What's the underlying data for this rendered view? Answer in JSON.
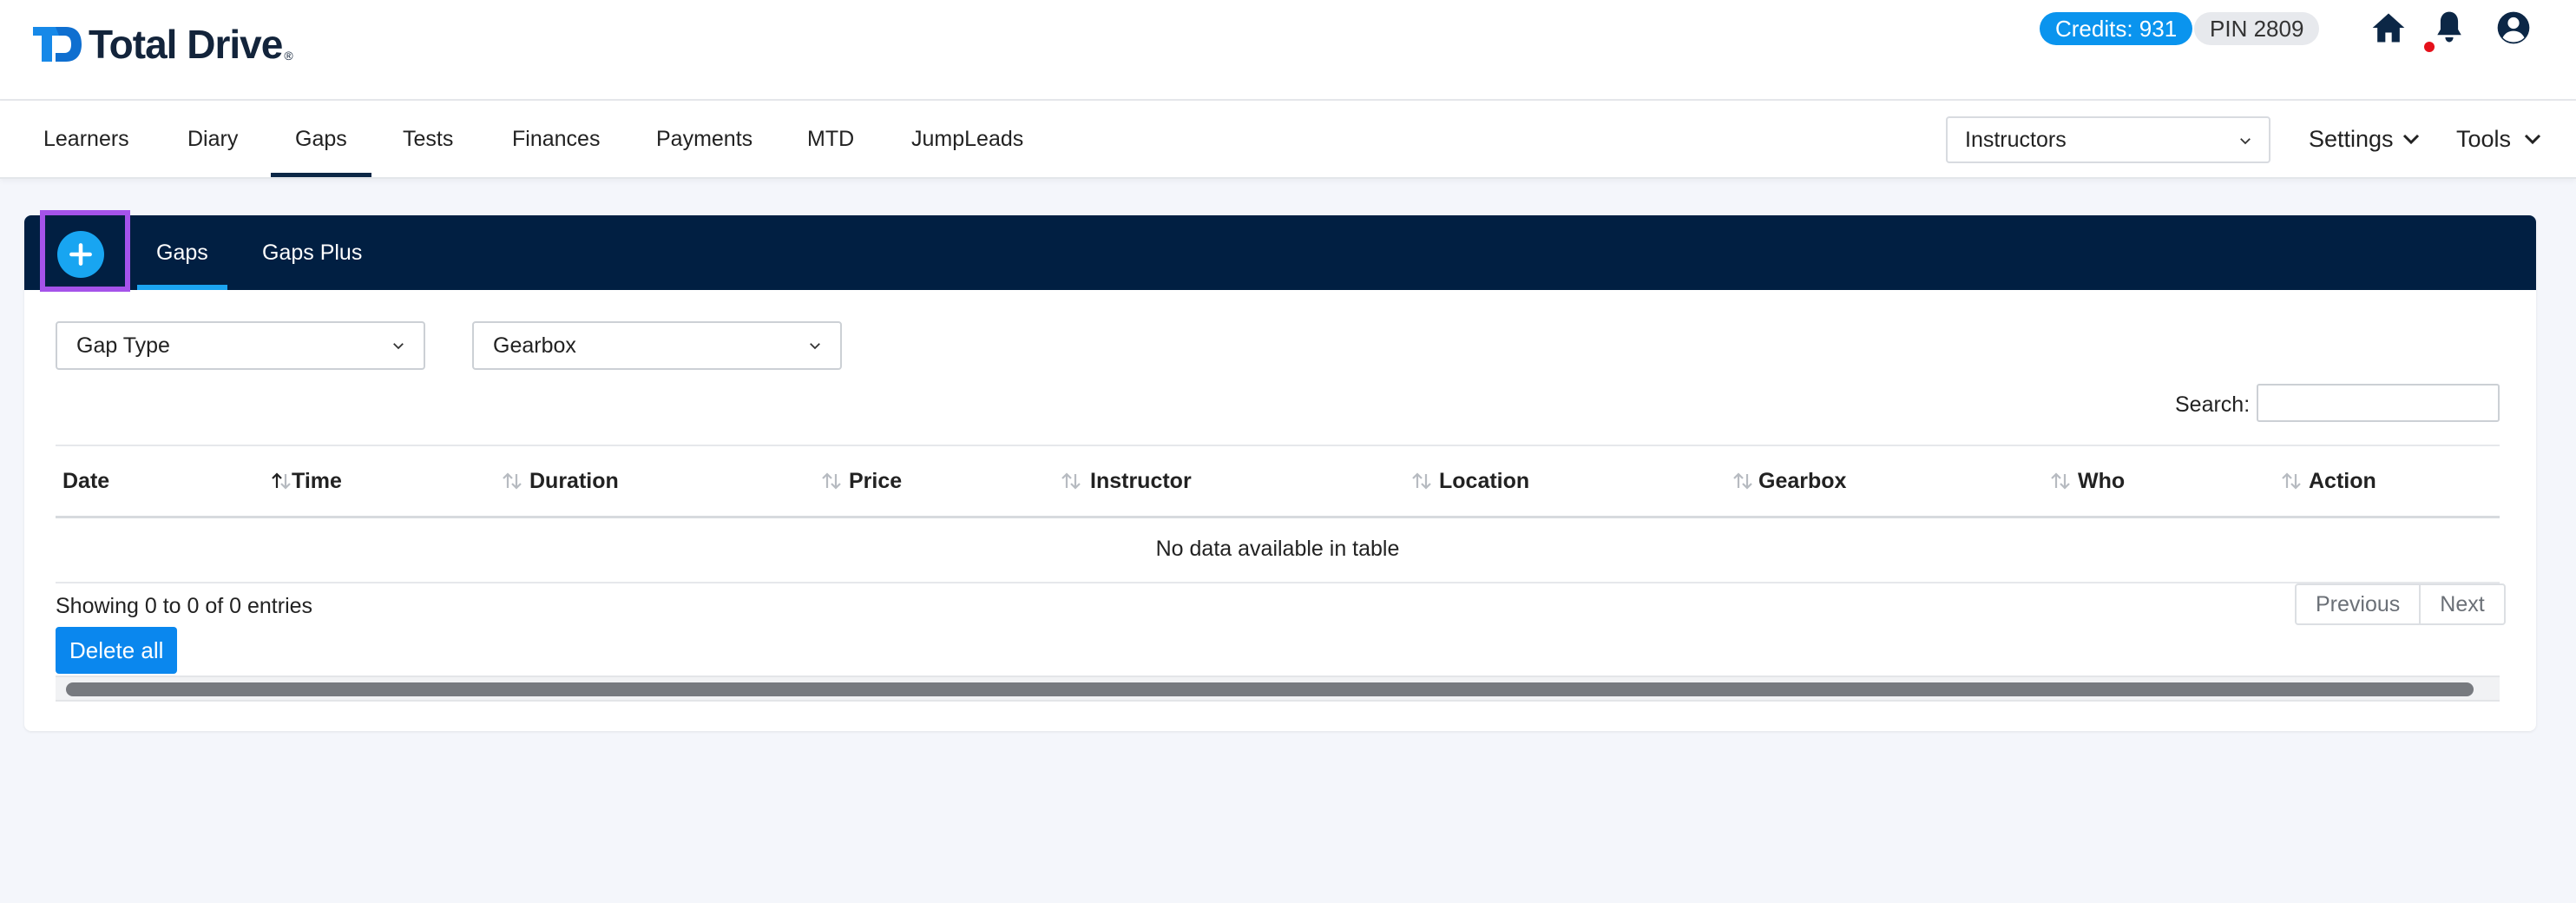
{
  "app": {
    "brand": "Total Drive",
    "brand_reg": "®",
    "credits_label": "Credits: 931",
    "pin_label": "PIN 2809"
  },
  "icons": {
    "home": "home-icon",
    "bell": "bell-icon",
    "account": "account-circle-icon",
    "add": "plus-icon",
    "sort": "sort-arrows-icon",
    "chevron": "chevron-down-icon"
  },
  "colors": {
    "brand_navy": "#011f42",
    "accent_blue": "#0a94ee",
    "highlight_purple": "#a553ea",
    "notification_red": "#e5111b"
  },
  "nav": {
    "items": [
      {
        "label": "Learners"
      },
      {
        "label": "Diary"
      },
      {
        "label": "Gaps"
      },
      {
        "label": "Tests"
      },
      {
        "label": "Finances"
      },
      {
        "label": "Payments"
      },
      {
        "label": "MTD"
      },
      {
        "label": "JumpLeads"
      }
    ],
    "active": "Gaps",
    "instructors_select": "Instructors",
    "settings_label": "Settings",
    "tools_label": "Tools"
  },
  "panel": {
    "tabs": [
      {
        "label": "Gaps"
      },
      {
        "label": "Gaps Plus"
      }
    ],
    "active_tab": "Gaps"
  },
  "filters": {
    "gap_type": "Gap Type",
    "gearbox": "Gearbox"
  },
  "search": {
    "label": "Search:",
    "value": ""
  },
  "table": {
    "columns": [
      "Date",
      "Time",
      "Duration",
      "Price",
      "Instructor",
      "Location",
      "Gearbox",
      "Who",
      "Action"
    ],
    "sorted_column": "Date",
    "empty_message": "No data available in table",
    "info": "Showing 0 to 0 of 0 entries",
    "pager": {
      "previous": "Previous",
      "next": "Next"
    },
    "delete_all_label": "Delete all"
  }
}
